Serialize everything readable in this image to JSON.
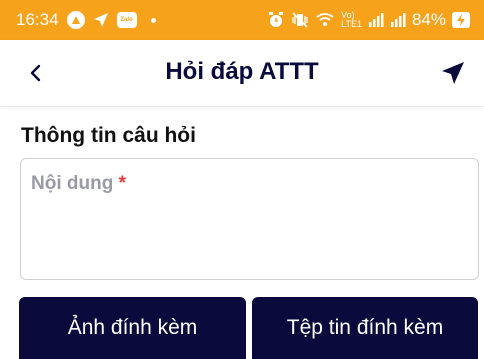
{
  "status_bar": {
    "time": "16:34",
    "volte_line1": "Vo)",
    "volte_line2": "LTE1",
    "battery_percent": "84%",
    "zalo_label": "Zalo"
  },
  "header": {
    "title": "Hỏi đáp ATTT"
  },
  "section": {
    "title": "Thông tin câu hỏi"
  },
  "content_field": {
    "label": "Nội dung",
    "required_mark": "*"
  },
  "buttons": {
    "attach_image": "Ảnh đính kèm",
    "attach_file": "Tệp tin đính kèm"
  },
  "colors": {
    "status_bar": "#f6a21a",
    "primary": "#0a0a3c",
    "required": "#e23b3b",
    "placeholder": "#9a9aa6"
  }
}
